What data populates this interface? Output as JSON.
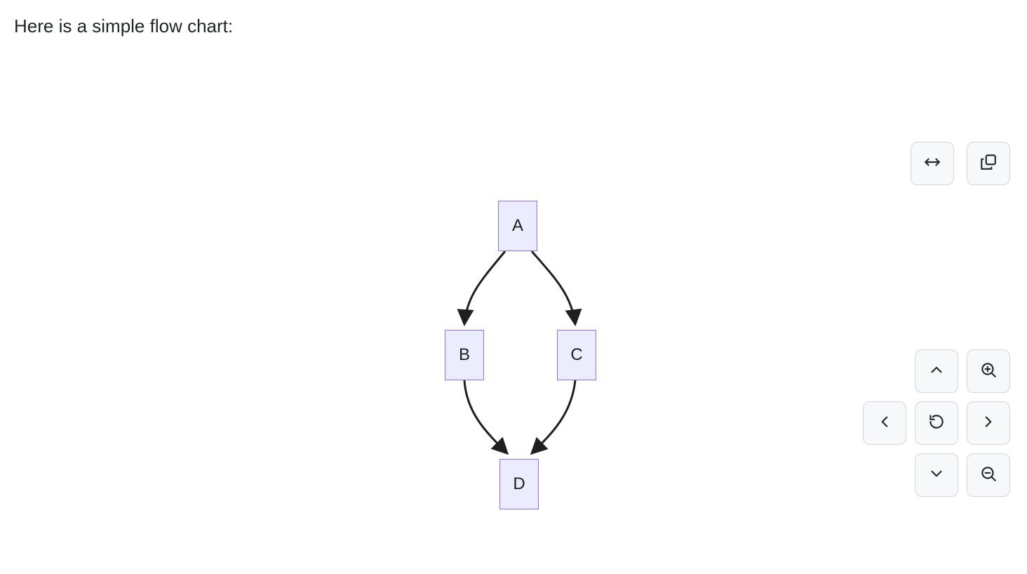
{
  "heading": "Here is a simple flow chart:",
  "diagram": {
    "type": "flowchart",
    "nodes": [
      {
        "id": "A",
        "label": "A"
      },
      {
        "id": "B",
        "label": "B"
      },
      {
        "id": "C",
        "label": "C"
      },
      {
        "id": "D",
        "label": "D"
      }
    ],
    "edges": [
      {
        "from": "A",
        "to": "B"
      },
      {
        "from": "A",
        "to": "C"
      },
      {
        "from": "B",
        "to": "D"
      },
      {
        "from": "C",
        "to": "D"
      }
    ]
  },
  "toolbar": {
    "fit_width": "Fit width",
    "copy": "Copy",
    "pan_up": "Pan up",
    "pan_down": "Pan down",
    "pan_left": "Pan left",
    "pan_right": "Pan right",
    "reset": "Reset",
    "zoom_in": "Zoom in",
    "zoom_out": "Zoom out"
  }
}
